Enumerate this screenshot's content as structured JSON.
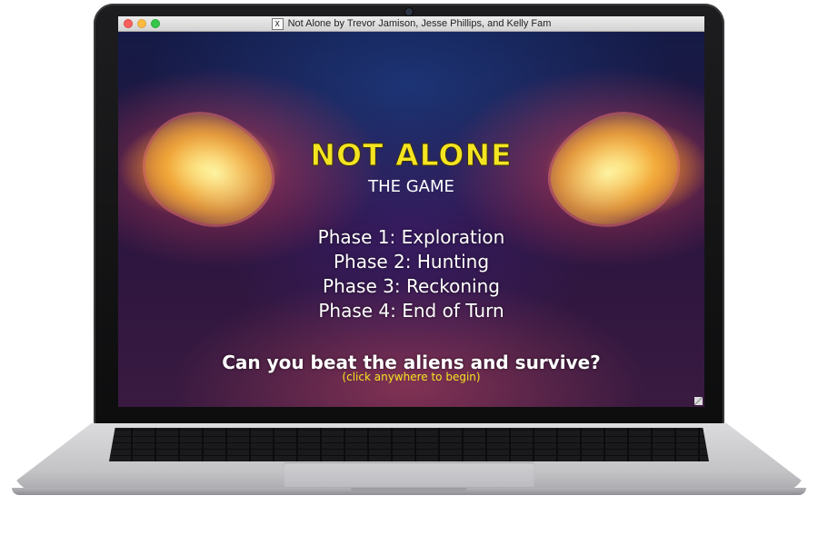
{
  "window": {
    "title": "Not Alone by Trevor Jamison, Jesse Phillips, and Kelly Fam",
    "app_icon": "x11-icon"
  },
  "game": {
    "title": "NOT ALONE",
    "subtitle": "THE GAME",
    "phases": [
      "Phase 1: Exploration",
      "Phase 2: Hunting",
      "Phase 3: Reckoning",
      "Phase 4: End of Turn"
    ],
    "tagline": "Can you beat the aliens and survive?",
    "hint": "(click anywhere to begin)"
  },
  "colors": {
    "title_yellow": "#f4e421",
    "hint_yellow": "#f4e421",
    "text_white": "#ffffff"
  }
}
